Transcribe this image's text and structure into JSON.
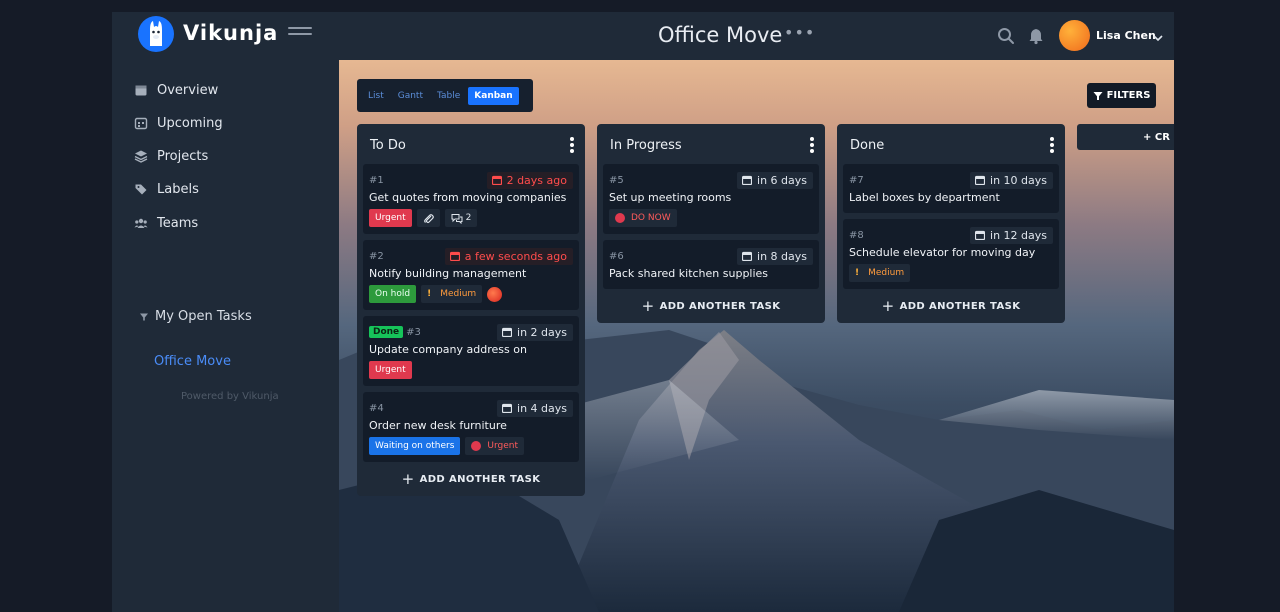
{
  "app": {
    "brand": "Vikunja"
  },
  "header": {
    "project_title": "Office Move",
    "project_menu": "•••",
    "user_name": "Lisa Chen",
    "icons": {
      "search": "search-icon",
      "bell": "bell-icon",
      "chevron": "chevron-down-icon"
    }
  },
  "sidebar": {
    "items": [
      {
        "label": "Overview",
        "icon": "calendar-icon"
      },
      {
        "label": "Upcoming",
        "icon": "calendar-grid-icon"
      },
      {
        "label": "Projects",
        "icon": "layers-icon"
      },
      {
        "label": "Labels",
        "icon": "tag-icon"
      },
      {
        "label": "Teams",
        "icon": "users-icon"
      }
    ],
    "saved_filter": "My Open Tasks",
    "active_project": "Office Move",
    "powered_by": "Powered by Vikunja"
  },
  "views": {
    "tabs": [
      "List",
      "Gantt",
      "Table",
      "Kanban"
    ],
    "active": "Kanban"
  },
  "filters_label": "FILTERS",
  "create_bucket_label": "+ CR",
  "buckets": [
    {
      "title": "To Do",
      "add_label": "ADD ANOTHER TASK",
      "cards": [
        {
          "id": "#1",
          "due": "2 days ago",
          "overdue": true,
          "title": "Get quotes from moving companies",
          "label": "Urgent",
          "comments": "2"
        },
        {
          "id": "#2",
          "due": "a few seconds ago",
          "overdue": true,
          "title": "Notify building management",
          "label": "On hold",
          "priority": "Medium"
        },
        {
          "id": "#3",
          "done": "Done",
          "due": "in 2 days",
          "title": "Update company address on website",
          "label": "Urgent"
        },
        {
          "id": "#4",
          "due": "in 4 days",
          "title": "Order new desk furniture",
          "label": "Waiting on others",
          "priority": "Urgent"
        }
      ]
    },
    {
      "title": "In Progress",
      "add_label": "ADD ANOTHER TASK",
      "cards": [
        {
          "id": "#5",
          "due": "in 6 days",
          "title": "Set up meeting rooms",
          "priority": "DO NOW"
        },
        {
          "id": "#6",
          "due": "in 8 days",
          "title": "Pack shared kitchen supplies"
        }
      ]
    },
    {
      "title": "Done",
      "add_label": "ADD ANOTHER TASK",
      "cards": [
        {
          "id": "#7",
          "due": "in 10 days",
          "title": "Label boxes by department"
        },
        {
          "id": "#8",
          "due": "in 12 days",
          "title": "Schedule elevator for moving day",
          "priority": "Medium"
        }
      ]
    }
  ],
  "colors": {
    "accent": "#1973ff",
    "urgent": "#e0394e",
    "on_hold": "#2d9a3c",
    "waiting": "#1a73e8",
    "done": "#16c45a"
  }
}
